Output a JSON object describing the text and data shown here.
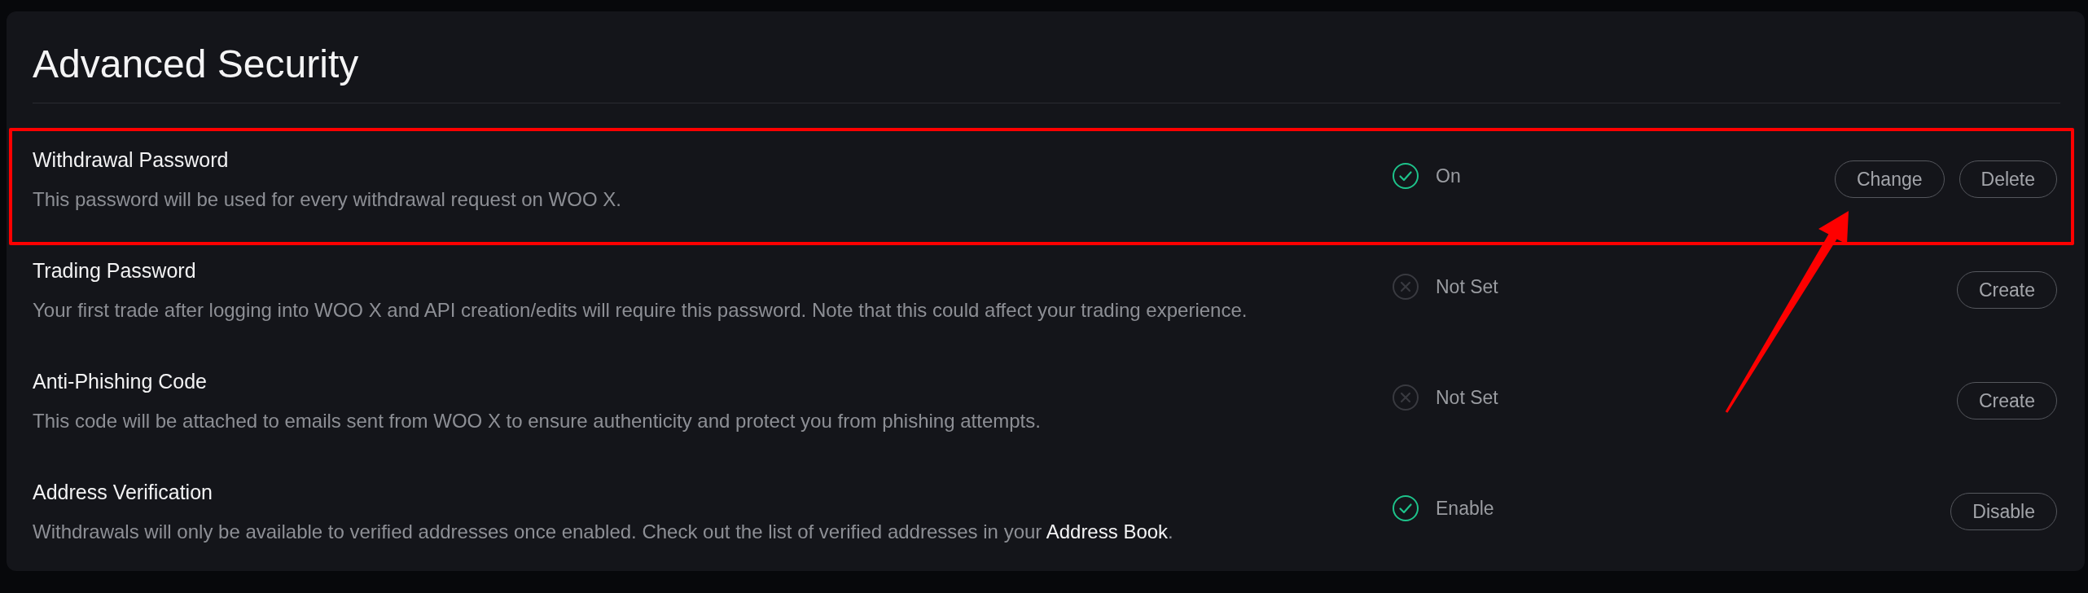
{
  "title": "Advanced Security",
  "settings": [
    {
      "name": "Withdrawal Password",
      "description": [
        {
          "kind": "text",
          "text": "This password will be used for every withdrawal request on WOO X."
        }
      ],
      "highlighted": true,
      "status": {
        "label": "On",
        "enabled": true
      },
      "buttons": [
        {
          "label": "Change",
          "arrow": true
        },
        {
          "label": "Delete",
          "arrow": false
        }
      ]
    },
    {
      "name": "Trading Password",
      "description": [
        {
          "kind": "text",
          "text": "Your first trade after logging into WOO X and API creation/edits will require this password. Note that this could affect your trading experience."
        }
      ],
      "highlighted": false,
      "status": {
        "label": "Not Set",
        "enabled": false
      },
      "buttons": [
        {
          "label": "Create",
          "arrow": false
        }
      ]
    },
    {
      "name": "Anti-Phishing Code",
      "description": [
        {
          "kind": "text",
          "text": "This code will be attached to emails sent from WOO X to ensure authenticity and protect you from phishing attempts."
        }
      ],
      "highlighted": false,
      "status": {
        "label": "Not Set",
        "enabled": false
      },
      "buttons": [
        {
          "label": "Create",
          "arrow": false
        }
      ]
    },
    {
      "name": "Address Verification",
      "description": [
        {
          "kind": "text",
          "text": "Withdrawals will only be available to verified addresses once enabled. Check out the list of verified addresses in your "
        },
        {
          "kind": "link",
          "text": "Address Book"
        },
        {
          "kind": "text",
          "text": "."
        }
      ],
      "highlighted": false,
      "status": {
        "label": "Enable",
        "enabled": true
      },
      "buttons": [
        {
          "label": "Disable",
          "arrow": false
        }
      ]
    }
  ]
}
